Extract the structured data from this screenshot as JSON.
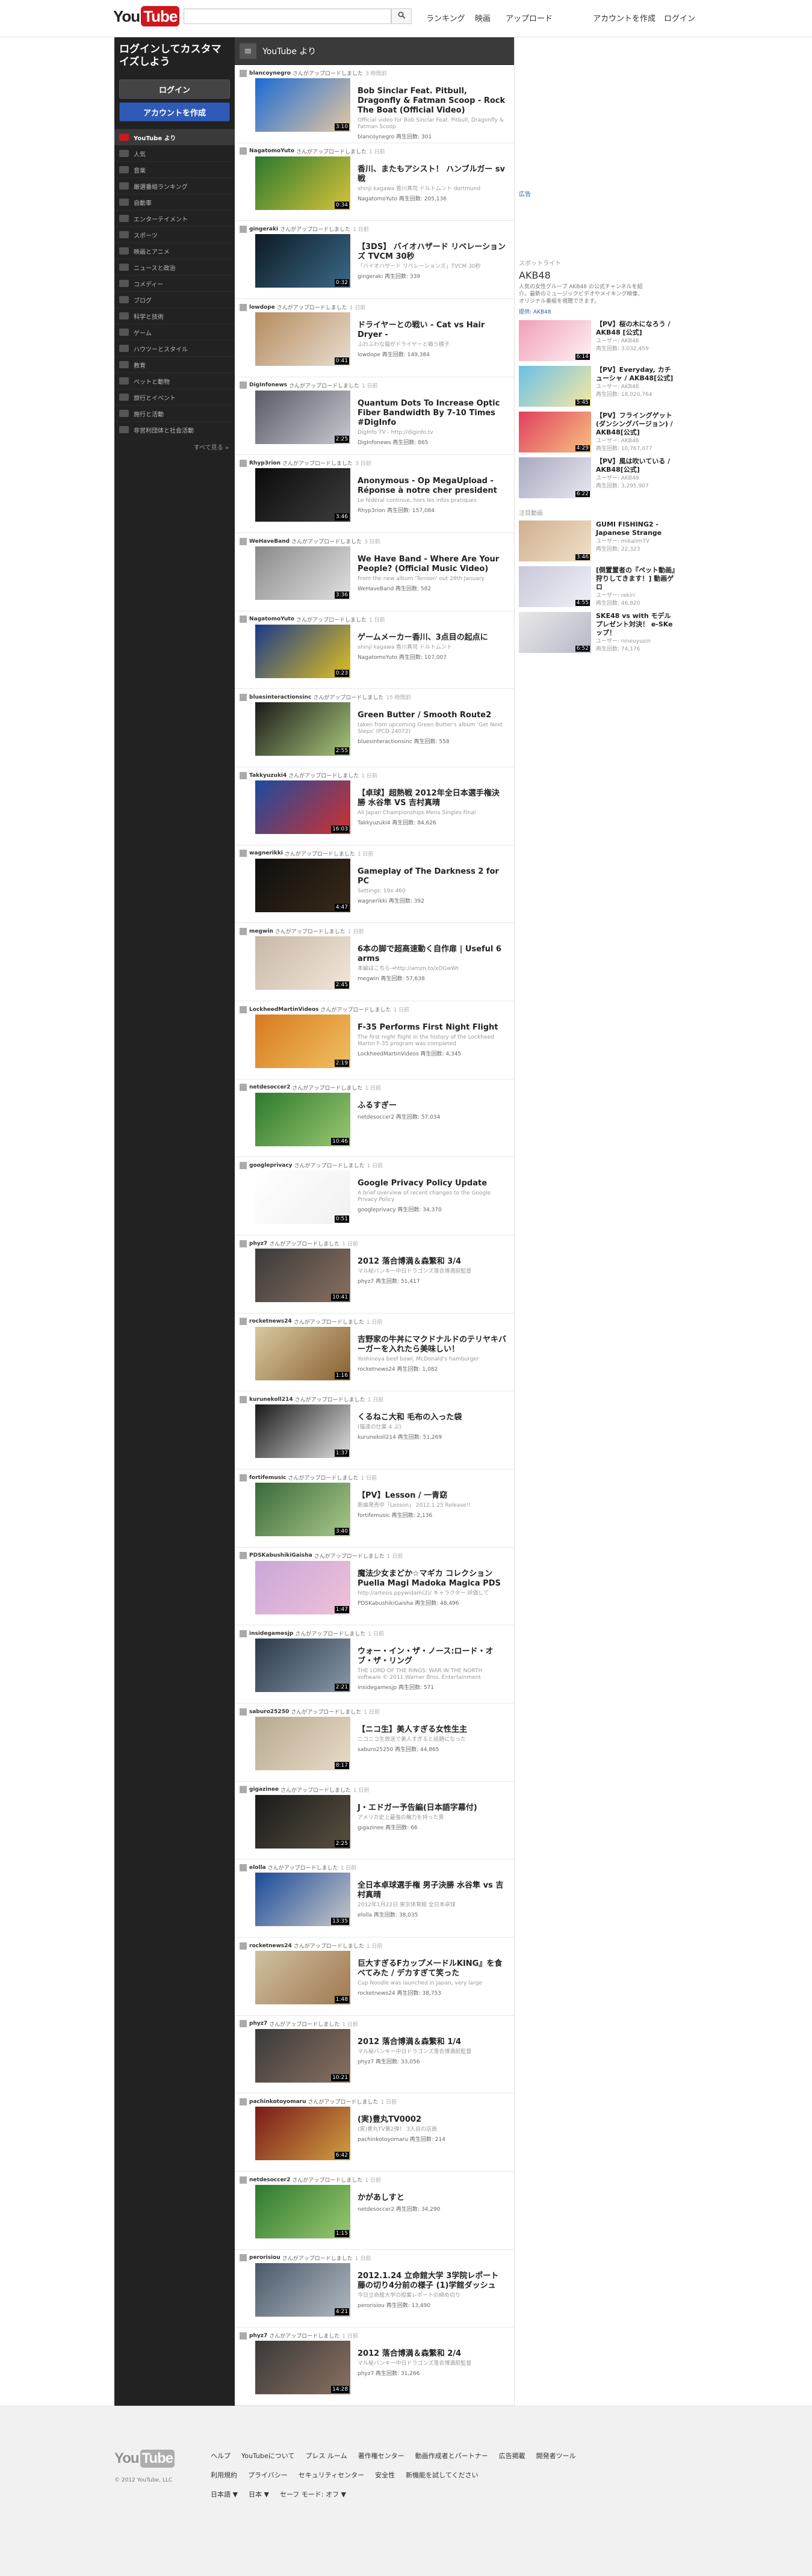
{
  "header": {
    "logo_you": "You",
    "logo_tube": "Tube",
    "search_placeholder": "",
    "links": [
      "ランキング",
      "映画",
      "アップロード",
      "アカウントを作成",
      "ログイン"
    ]
  },
  "guide": {
    "title": "ログインしてカスタマイズしよう",
    "login_button": "ログイン",
    "create_account_button": "アカウントを作成",
    "items": [
      "YouTube より",
      "人気",
      "音楽",
      "厳選番組ランキング",
      "自動車",
      "エンターテイメント",
      "スポーツ",
      "映画とアニメ",
      "ニュースと政治",
      "コメディー",
      "ブログ",
      "科学と技術",
      "ゲーム",
      "ハウツーとスタイル",
      "教育",
      "ペットと動物",
      "旅行とイベント",
      "施行と活動",
      "非営利団体と社会活動"
    ],
    "see_all": "すべて見る »"
  },
  "feed": {
    "heading": "YouTube より",
    "items": [
      {
        "user": "blancoynegro",
        "action": "さんがアップロードしました",
        "time": "3 時間前",
        "title": "Bob Sinclar Feat. Pitbull, Dragonfly & Fatman Scoop - Rock The Boat (Official Video)",
        "desc": "Official video for Bob Sinclar Feat. Pitbull, Dragonfly & Fatman Scoop",
        "meta": "blancoynegro 再生回数: 301",
        "dur": "3:10",
        "thumb": [
          "#1a6bd6",
          "#e6c7a0"
        ]
      },
      {
        "user": "NagatomoYuto",
        "action": "さんがアップロードしました",
        "time": "1 日前",
        "title": "香川、またもアシスト！ ハンブルガー sv戦",
        "desc": "shinji kagawa 香川真司 ドルトムント dortmund",
        "meta": "NagatomoYuto 再生回数: 205,136",
        "dur": "0:34",
        "thumb": [
          "#2a7a2e",
          "#d8c23a"
        ]
      },
      {
        "user": "gingeraki",
        "action": "さんがアップロードしました",
        "time": "1 日前",
        "title": "【3DS】 バイオハザード リベレーションズ TVCM 30秒",
        "desc": "「バイオハザード リベレーションズ」TVCM 30秒",
        "meta": "gingeraki 再生回数: 339",
        "dur": "0:32",
        "thumb": [
          "#0d1a24",
          "#3b6a88"
        ]
      },
      {
        "user": "lowdope",
        "action": "さんがアップロードしました",
        "time": "1 日前",
        "title": "ドライヤーとの戦い - Cat vs Hair Dryer -",
        "desc": "ふわふわな猫がドライヤーと戦う様子",
        "meta": "lowdope 再生回数: 149,384",
        "dur": "0:41",
        "thumb": [
          "#b58c5e",
          "#e8ddd0"
        ]
      },
      {
        "user": "DigInfonews",
        "action": "さんがアップロードしました",
        "time": "1 日前",
        "title": "Quantum Dots To Increase Optic Fiber Bandwidth By 7-10 Times #DigInfo",
        "desc": "DigInfo TV - http://diginfo.tv",
        "meta": "DigInfonews 再生回数: 865",
        "dur": "2:25",
        "thumb": [
          "#5a5a66",
          "#c8c8d0"
        ]
      },
      {
        "user": "Rhyp3rion",
        "action": "さんがアップロードしました",
        "time": "3 日前",
        "title": "Anonymous - Op MegaUpload - Réponse à notre cher president",
        "desc": "Le fédéral continue, hors les infos pratiques",
        "meta": "Rhyp3rion 再生回数: 157,084",
        "dur": "3:46",
        "thumb": [
          "#0b0b0b",
          "#3d3d3d"
        ]
      },
      {
        "user": "WeHaveBand",
        "action": "さんがアップロードしました",
        "time": "3 日前",
        "title": "We Have Band - Where Are Your People? (Official Music Video)",
        "desc": "From the new album 'Ternion' out 28th January",
        "meta": "WeHaveBand 再生回数: 582",
        "dur": "3:36",
        "thumb": [
          "#8a8a8a",
          "#e0e0e0"
        ]
      },
      {
        "user": "NagatomoYuto",
        "action": "さんがアップロードしました",
        "time": "1 日前",
        "title": "ゲームメーカー香川、3点目の起点に",
        "desc": "shinji kagawa 香川真司 ドルトムント",
        "meta": "NagatomoYuto 再生回数: 107,007",
        "dur": "0:23",
        "thumb": [
          "#1a3a8a",
          "#e0c020"
        ]
      },
      {
        "user": "bluesinteractionsinc",
        "action": "さんがアップロードしました",
        "time": "15 時間前",
        "title": "Green Butter / Smooth Route2",
        "desc": "taken from upcoming Green Butter's album 'Get Next Steps' (PCD-24072)",
        "meta": "bluesinteractionsinc 再生回数: 558",
        "dur": "2:55",
        "thumb": [
          "#1a1a1a",
          "#a8c87a"
        ]
      },
      {
        "user": "Takkyuzuki4",
        "action": "さんがアップロードしました",
        "time": "1 日前",
        "title": "【卓球】超熱戦 2012年全日本選手権決勝 水谷隼 VS 吉村真晴",
        "desc": "All Japan Championships Mens Singles Final",
        "meta": "Takkyuzuki4 再生回数: 84,626",
        "dur": "16:03",
        "thumb": [
          "#1a4ca0",
          "#d03030"
        ]
      },
      {
        "user": "wagnerikki",
        "action": "さんがアップロードしました",
        "time": "1 日前",
        "title": "Gameplay of The Darkness 2 for PC",
        "desc": "Settings: 19x 460",
        "meta": "wagnerikki 再生回数: 392",
        "dur": "4:47",
        "thumb": [
          "#0e0e0e",
          "#3a2a18"
        ]
      },
      {
        "user": "megwin",
        "action": "さんがアップロードしました",
        "time": "1 日前",
        "title": "6本の脚で超高速動く自作扉 | Useful 6 arms",
        "desc": "本編はこちら→http://amzn.to/xOGwWt",
        "meta": "megwin 再生回数: 57,638",
        "dur": "2:45",
        "thumb": [
          "#c8b8a8",
          "#f2e6d8"
        ]
      },
      {
        "user": "LockheedMartinVideos",
        "action": "さんがアップロードしました",
        "time": "1 日前",
        "title": "F-35 Performs First Night Flight",
        "desc": "The first night flight in the history of the Lockheed Martin F-35 program was completed",
        "meta": "LockheedMartinVideos 再生回数: 4,345",
        "dur": "2:19",
        "thumb": [
          "#d87a20",
          "#f0c060"
        ]
      },
      {
        "user": "netdesoccer2",
        "action": "さんがアップロードしました",
        "time": "1 日前",
        "title": "ふるすぎー",
        "desc": "",
        "meta": "netdesoccer2 再生回数: 57,034",
        "dur": "10:46",
        "thumb": [
          "#2e7a2e",
          "#9ac870"
        ]
      },
      {
        "user": "googleprivacy",
        "action": "さんがアップロードしました",
        "time": "1 日前",
        "title": "Google Privacy Policy Update",
        "desc": "A brief overview of recent changes to the Google Privacy Policy",
        "meta": "googleprivacy 再生回数: 34,370",
        "dur": "0:51",
        "thumb": [
          "#ffffff",
          "#f0f0f0"
        ]
      },
      {
        "user": "phyz7",
        "action": "さんがアップロードしました",
        "time": "1 日前",
        "title": "2012 落合博満＆森繁和 3/4",
        "desc": "マル秘バンキー中日ドラゴンズ落合博満前監督",
        "meta": "phyz7 再生回数: 51,417",
        "dur": "10:41",
        "thumb": [
          "#3a3a3a",
          "#8a7060"
        ]
      },
      {
        "user": "rocketnews24",
        "action": "さんがアップロードしました",
        "time": "1 日前",
        "title": "吉野家の牛丼にマクドナルドのテリヤキバーガーを入れたら美味しい！",
        "desc": "Yoshinoya beef bowl, McDonald's hamburger",
        "meta": "rocketnews24 再生回数: 1,082",
        "dur": "1:16",
        "thumb": [
          "#d8c8a0",
          "#8a6030"
        ]
      },
      {
        "user": "kurunekoll214",
        "action": "さんがアップロードしました",
        "time": "1 日前",
        "title": "くるねこ大和 毛布の入った袋",
        "desc": "(猫達の仕業 4 ぷ)",
        "meta": "kurunekoll214 再生回数: 51,269",
        "dur": "1:37",
        "thumb": [
          "#1a1a1a",
          "#e0e0e0"
        ]
      },
      {
        "user": "fortifemusic",
        "action": "さんがアップロードしました",
        "time": "1 日前",
        "title": "【PV】Lesson / 一青窈",
        "desc": "新曲発売中「Lesson」 2012.1.25 Release!!",
        "meta": "fortifemusic 再生回数: 2,136",
        "dur": "3:40",
        "thumb": [
          "#3a6a3a",
          "#aac88a"
        ]
      },
      {
        "user": "PDSKabushikiGaisha",
        "action": "さんがアップロードしました",
        "time": "1 日前",
        "title": "魔法少女まどか☆マギカ コレクション Puella Magi Madoka Magica PDS",
        "desc": "http://artesis.ppywidam(2)/ キャラクター 評価して",
        "meta": "PDSKabushikiGaisha 再生回数: 48,496",
        "dur": "1:47",
        "thumb": [
          "#c8a8d8",
          "#f0c0d8"
        ]
      },
      {
        "user": "insidegamesjp",
        "action": "さんがアップロードしました",
        "time": "1 日前",
        "title": "ウォー・イン・ザ・ノース:ロード・オブ・ザ・リング",
        "desc": "THE LORD OF THE RINGS: WAR IN THE NORTH software © 2011 Warner Bros. Entertainment",
        "meta": "insidegamesjp 再生回数: 571",
        "dur": "2:21",
        "thumb": [
          "#2a3a4a",
          "#8898a8"
        ]
      },
      {
        "user": "saburo25250",
        "action": "さんがアップロードしました",
        "time": "1 日前",
        "title": "【ニコ生】美人すぎる女性生主",
        "desc": "ニコニコ生放送で美人すぎると話題になった",
        "meta": "saburo25250 再生回数: 44,865",
        "dur": "8:17",
        "thumb": [
          "#b8a890",
          "#e8dcc8"
        ]
      },
      {
        "user": "gigazinee",
        "action": "さんがアップロードしました",
        "time": "1 日前",
        "title": "J・エドガー予告編(日本語字幕付)",
        "desc": "アメリカ史上最強の権力を持った男",
        "meta": "gigazinee 再生回数: 66",
        "dur": "2:25",
        "thumb": [
          "#1a1a1a",
          "#5a5040"
        ]
      },
      {
        "user": "elolla",
        "action": "さんがアップロードしました",
        "time": "1 日前",
        "title": "全日本卓球選手権 男子決勝 水谷隼 vs 吉村真晴",
        "desc": "2012年1月22日 東京体育館 全日本卓球",
        "meta": "elolla 再生回数: 38,035",
        "dur": "13:35",
        "thumb": [
          "#1a4a9a",
          "#c8c8c8"
        ]
      },
      {
        "user": "rocketnews24",
        "action": "さんがアップロードしました",
        "time": "1 日前",
        "title": "巨大すぎるFカップメ一ドルKING』を食べてみた / デカすぎて笑った",
        "desc": "Cup Noodle was launched in Japan, very large",
        "meta": "rocketnews24 再生回数: 38,753",
        "dur": "1:48",
        "thumb": [
          "#d0c0a0",
          "#a07850"
        ]
      },
      {
        "user": "phyz7",
        "action": "さんがアップロードしました",
        "time": "1 日前",
        "title": "2012 落合博満＆森繁和 1/4",
        "desc": "マル秘バンキー中日ドラゴンズ落合博満前監督",
        "meta": "phyz7 再生回数: 33,056",
        "dur": "10:21",
        "thumb": [
          "#3a3a3a",
          "#8a7060"
        ]
      },
      {
        "user": "pachinkotoyomaru",
        "action": "さんがアップロードしました",
        "time": "1 日前",
        "title": "(実)豊丸TV0002",
        "desc": "(実)豊丸TV第2弾！ 3人目の店員",
        "meta": "pachinkotoyomaru 再生回数: 214",
        "dur": "6:42",
        "thumb": [
          "#7a1a1a",
          "#d0a040"
        ]
      },
      {
        "user": "netdesoccer2",
        "action": "さんがアップロードしました",
        "time": "1 日前",
        "title": "かがあしすと",
        "desc": "",
        "meta": "netdesoccer2 再生回数: 34,290",
        "dur": "1:15",
        "thumb": [
          "#2e7a2e",
          "#9ac870"
        ]
      },
      {
        "user": "perorisiou",
        "action": "さんがアップロードしました",
        "time": "1 日前",
        "title": "2012.1.24 立命館大学 3学院レポート 藤の切り4分前の様子 (1)学館ダッシュ",
        "desc": "今日立命館大学の授業レポートの締め切り",
        "meta": "perorisiou 再生回数: 13,490",
        "dur": "4:21",
        "thumb": [
          "#4a5a6a",
          "#b0b8c0"
        ]
      },
      {
        "user": "phyz7",
        "action": "さんがアップロードしました",
        "time": "1 日前",
        "title": "2012 落合博満＆森繁和 2/4",
        "desc": "マル秘バンキー中日ドラゴンズ落合博満前監督",
        "meta": "phyz7 再生回数: 31,266",
        "dur": "14:28",
        "thumb": [
          "#3a3a3a",
          "#8a7060"
        ]
      }
    ]
  },
  "right": {
    "ad_label": "広告",
    "spotlight_label": "スポットライト",
    "spotlight_title": "AKB48",
    "spotlight_desc": "人気の女性グループ AKB48 の公式チャンネルを紹介。最新のミュージックビデオやメイキング映像、オリジナル番組を視聴できます。",
    "spotlight_by": "提供: AKB48",
    "spotlight_videos": [
      {
        "title": "【PV】桜の木になろう / AKB48 [公式]",
        "by": "ユーザー: AKB48",
        "views": "再生回数: 3,032,459",
        "dur": "6:14",
        "thumb": [
          "#f0a0b8",
          "#fff0f4"
        ]
      },
      {
        "title": "【PV】Everyday, カチューシャ / AKB48[公式]",
        "by": "ユーザー: AKB48",
        "views": "再生回数: 18,020,764",
        "dur": "5:45",
        "thumb": [
          "#6ac0e8",
          "#f8e8a0"
        ]
      },
      {
        "title": "【PV】フライングゲット (ダンシングバージョン) / AKB48[公式]",
        "by": "ユーザー: AKB48",
        "views": "再生回数: 10,767,077",
        "dur": "4:29",
        "thumb": [
          "#e04060",
          "#f8c080"
        ]
      },
      {
        "title": "【PV】風は吹いている / AKB48[公式]",
        "by": "ユーザー: AKB48",
        "views": "再生回数: 3,295,907",
        "dur": "6:22",
        "thumb": [
          "#a8a8c0",
          "#e8e8f0"
        ]
      }
    ],
    "featured_label": "注目動画",
    "featured_videos": [
      {
        "title": "GUMI FISHING2 - Japanese Strange",
        "by": "ユーザー: mikalimTV",
        "views": "再生回数: 22,323",
        "dur": "3:46",
        "thumb": [
          "#d0b090",
          "#f0e0c8"
        ]
      },
      {
        "title": "[倒置置者の『ペット動画』狩りしてきます！] 動画ゲロ",
        "by": "ユーザー: rekiri",
        "views": "再生回数: 46,820",
        "dur": "4:55",
        "thumb": [
          "#c8c8d8",
          "#f0f0f8"
        ]
      },
      {
        "title": "SKE48 vs with モデル プレゼント対決！ e-SKeップ！",
        "by": "ユーザー: nineuyusin",
        "views": "再生回数: 74,176",
        "dur": "6:52",
        "thumb": [
          "#e8e8e8",
          "#b8b8c8"
        ]
      }
    ]
  },
  "footer": {
    "logo_you": "You",
    "logo_tube": "Tube",
    "copyright": "© 2012 YouTube, LLC",
    "row1": [
      "ヘルプ",
      "YouTubeについて",
      "プレス ルーム",
      "著作権センター",
      "動画作成者とパートナー",
      "広告掲載",
      "開発者ツール"
    ],
    "row2": [
      "利用規約",
      "プライバシー",
      "セキュリティセンター",
      "安全性",
      "新機能を試してください"
    ],
    "row3": [
      "日本語 ▼",
      "日本 ▼",
      "セーフ モード: オフ ▼"
    ]
  }
}
